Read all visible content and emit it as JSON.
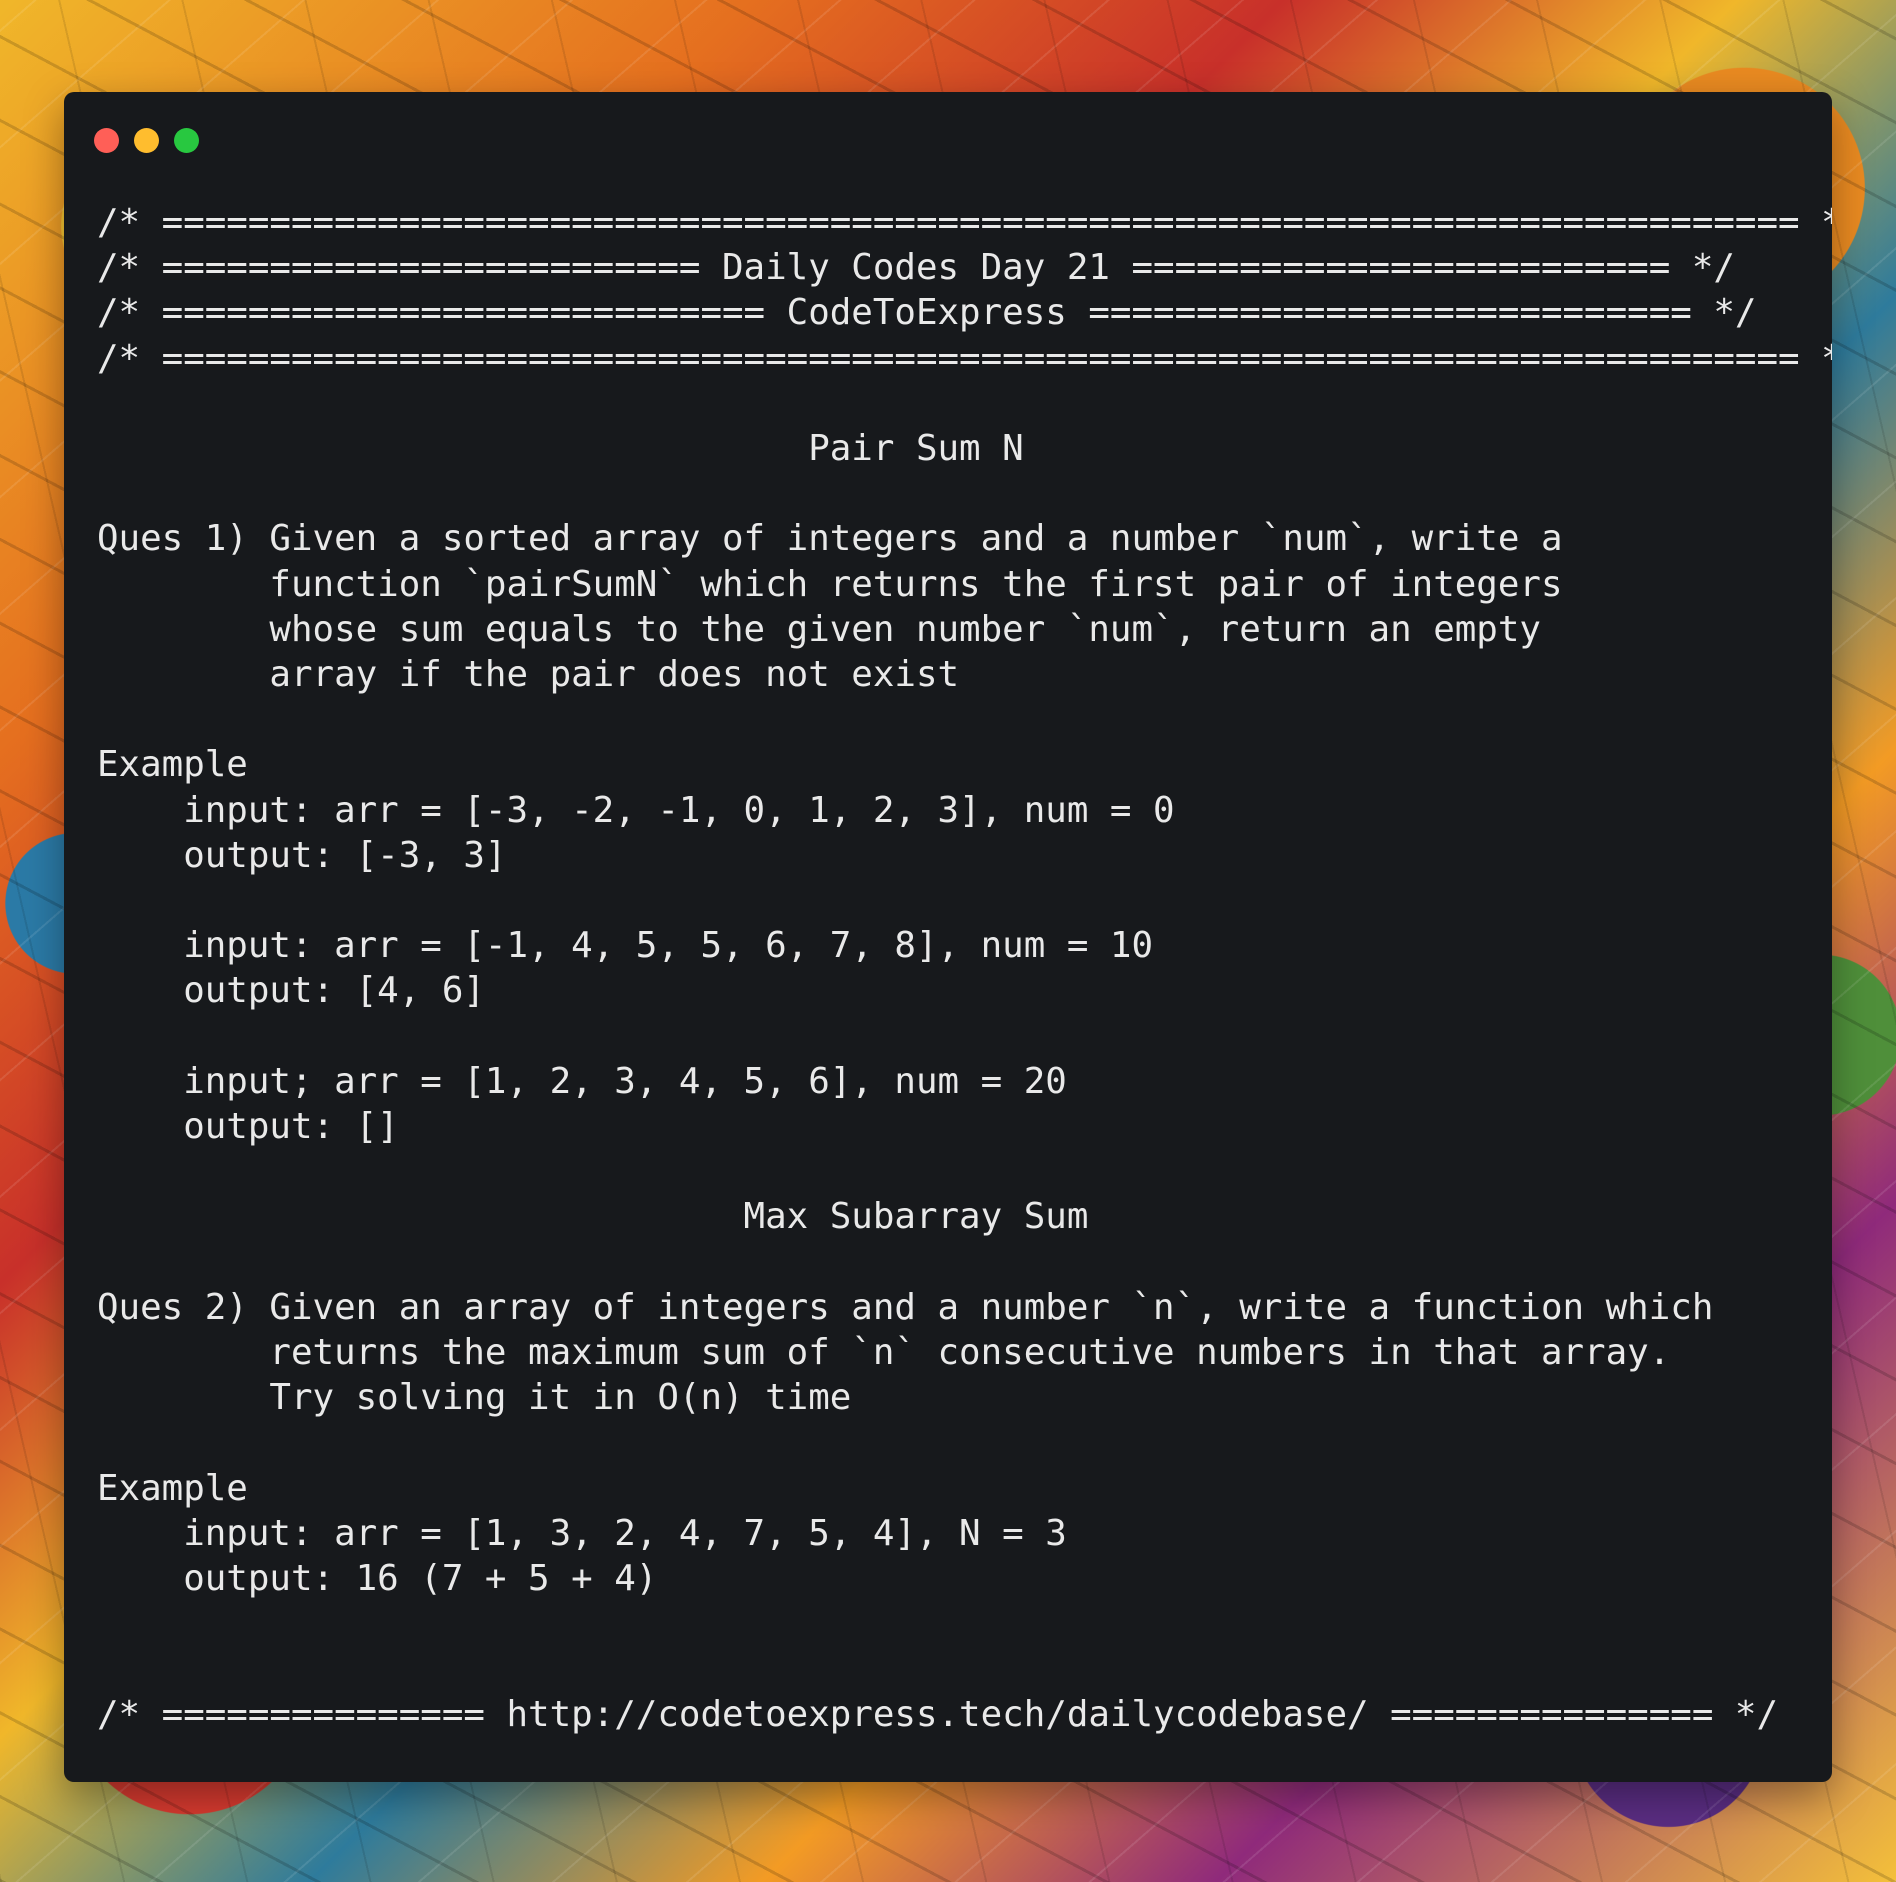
{
  "window": {
    "traffic_lights": [
      {
        "name": "close",
        "color": "#ff5f57"
      },
      {
        "name": "minimize",
        "color": "#ffbd2e"
      },
      {
        "name": "zoom",
        "color": "#28c840"
      }
    ]
  },
  "code": {
    "line_01": "/* ============================================================================ */",
    "line_02": "/* ========================= Daily Codes Day 21 ========================= */",
    "line_03": "/* ============================ CodeToExpress ============================ */",
    "line_04": "/* ============================================================================ */",
    "line_05": "",
    "line_06": "                                 Pair Sum N",
    "line_07": "",
    "line_08": "Ques 1) Given a sorted array of integers and a number `num`, write a",
    "line_09": "        function `pairSumN` which returns the first pair of integers",
    "line_10": "        whose sum equals to the given number `num`, return an empty",
    "line_11": "        array if the pair does not exist",
    "line_12": "",
    "line_13": "Example",
    "line_14": "    input: arr = [-3, -2, -1, 0, 1, 2, 3], num = 0",
    "line_15": "    output: [-3, 3]",
    "line_16": "",
    "line_17": "    input: arr = [-1, 4, 5, 5, 6, 7, 8], num = 10",
    "line_18": "    output: [4, 6]",
    "line_19": "",
    "line_20": "    input; arr = [1, 2, 3, 4, 5, 6], num = 20",
    "line_21": "    output: []",
    "line_22": "",
    "line_23": "                              Max Subarray Sum",
    "line_24": "",
    "line_25": "Ques 2) Given an array of integers and a number `n`, write a function which",
    "line_26": "        returns the maximum sum of `n` consecutive numbers in that array.",
    "line_27": "        Try solving it in O(n) time",
    "line_28": "",
    "line_29": "Example",
    "line_30": "    input: arr = [1, 3, 2, 4, 7, 5, 4], N = 3",
    "line_31": "    output: 16 (7 + 5 + 4)",
    "line_32": "",
    "line_33": "",
    "line_34": "/* =============== http://codetoexpress.tech/dailycodebase/ =============== */"
  }
}
